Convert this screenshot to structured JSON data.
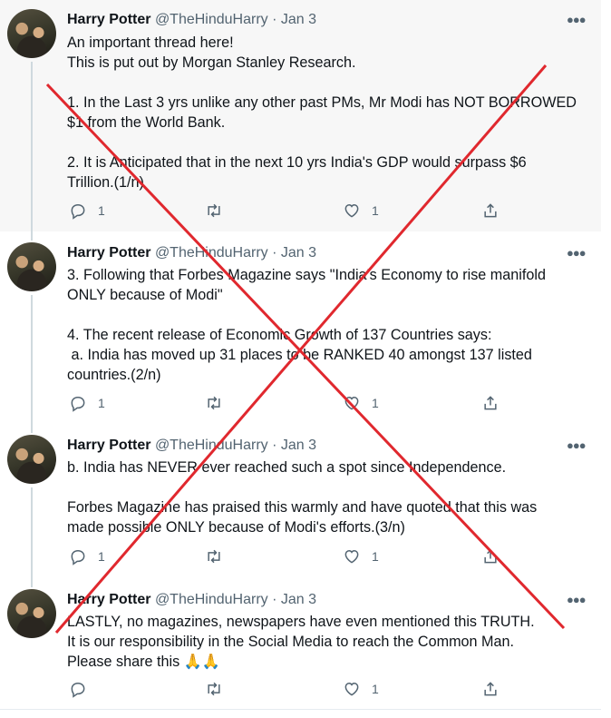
{
  "tweets": [
    {
      "name": "Harry Potter",
      "handle": "@TheHinduHarry",
      "sep": "·",
      "date": "Jan 3",
      "lines": [
        "An important thread here!",
        "This is put out by Morgan Stanley Research.",
        "",
        "1. In the Last 3 yrs unlike any other past PMs, Mr Modi has NOT BORROWED",
        "$1 from the World Bank.",
        "",
        "2. It is Anticipated that in the next 10 yrs India's GDP would surpass $6",
        "Trillion.(1/n)"
      ],
      "replies": "1",
      "likes": "1"
    },
    {
      "name": "Harry Potter",
      "handle": "@TheHinduHarry",
      "sep": "·",
      "date": "Jan 3",
      "lines": [
        "3. Following that Forbes Magazine says \"India's Economy to rise manifold",
        "ONLY because of Modi\"",
        "",
        "4. The recent release of Economic Growth of 137 Countries says:",
        " a. India has moved up 31 places to be RANKED 40 amongst 137 listed",
        "countries.(2/n)"
      ],
      "replies": "1",
      "likes": "1"
    },
    {
      "name": "Harry Potter",
      "handle": "@TheHinduHarry",
      "sep": "·",
      "date": "Jan 3",
      "lines": [
        "b. India has NEVER ever reached such a spot since Independence.",
        "",
        "Forbes Magazine has praised this warmly and have quoted that this was",
        "made possible ONLY because of Modi's efforts.(3/n)"
      ],
      "replies": "1",
      "likes": "1"
    },
    {
      "name": "Harry Potter",
      "handle": "@TheHinduHarry",
      "sep": "·",
      "date": "Jan 3",
      "lines": [
        "LASTLY, no magazines, newspapers have even mentioned this TRUTH.",
        "It is our responsibility in the Social Media to reach the Common Man.",
        "Please share this 🙏🙏"
      ],
      "replies": "",
      "likes": "1"
    }
  ],
  "icons": {
    "more": "more-icon",
    "reply": "reply-icon",
    "retweet": "retweet-icon",
    "like": "like-icon",
    "share": "share-icon"
  },
  "colors": {
    "cross": "#e0282e",
    "highlight_bg": "#f7f7f7",
    "muted": "#536471"
  }
}
